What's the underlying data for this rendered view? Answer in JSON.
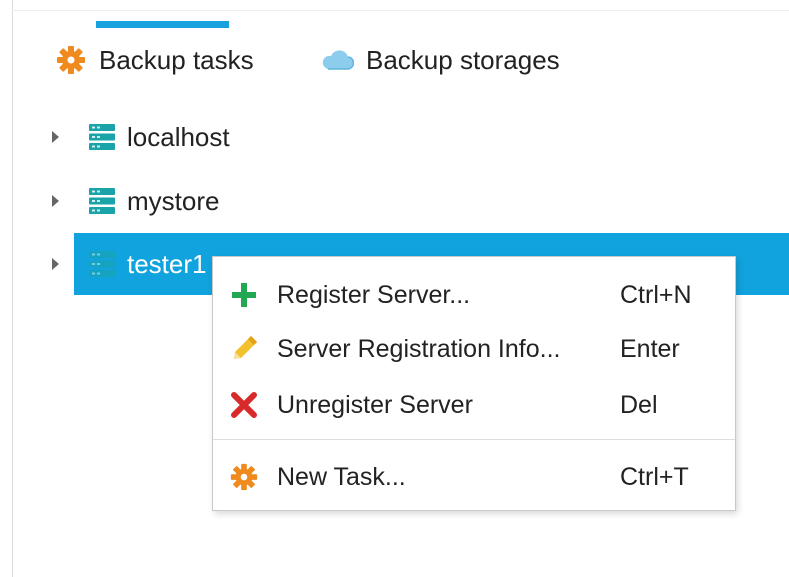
{
  "tabs": {
    "backup_tasks": "Backup tasks",
    "backup_storages": "Backup storages"
  },
  "tree": {
    "items": [
      {
        "label": "localhost"
      },
      {
        "label": "mystore"
      },
      {
        "label": "tester1"
      }
    ]
  },
  "context_menu": {
    "items": [
      {
        "label": "Register Server...",
        "shortcut": "Ctrl+N",
        "icon": "plus-icon"
      },
      {
        "label": "Server Registration Info...",
        "shortcut": "Enter",
        "icon": "pencil-icon"
      },
      {
        "label": "Unregister Server",
        "shortcut": "Del",
        "icon": "x-icon"
      },
      {
        "label": "New Task...",
        "shortcut": "Ctrl+T",
        "icon": "gear-icon"
      }
    ]
  },
  "colors": {
    "accent": "#16a2dc",
    "selection": "#11a3dd",
    "plus": "#22a852",
    "pencil": "#f2c12e",
    "x": "#d82a2a",
    "gear": "#ef8a1f",
    "server": "#1aa3a8"
  }
}
